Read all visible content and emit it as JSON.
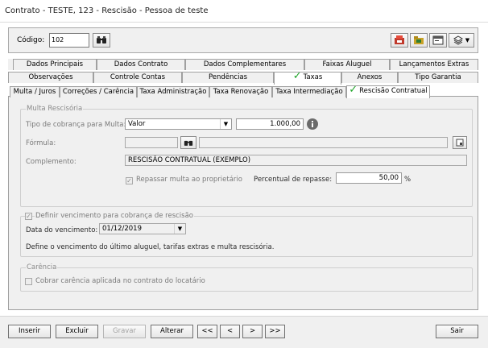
{
  "window": {
    "title": "Contrato - TESTE, 123 - Rescisão - Pessoa de teste"
  },
  "header": {
    "codigo_label": "Código:",
    "codigo_value": "102"
  },
  "tabs_row1": [
    "Dados Principais",
    "Dados Contrato",
    "Dados Complementares",
    "Faixas Aluguel",
    "Lançamentos Extras"
  ],
  "tabs_row2": [
    "Observações",
    "Controle Contas",
    "Pendências",
    "Taxas",
    "Anexos",
    "Tipo Garantia"
  ],
  "subtabs": [
    "Multa / Juros",
    "Correções / Carência",
    "Taxa Administração",
    "Taxa Renovação",
    "Taxa Intermediação",
    "Rescisão Contratual"
  ],
  "multa": {
    "group_title": "Multa Rescisória",
    "tipo_label": "Tipo de cobrança para Multa:",
    "tipo_value": "Valor",
    "valor": "1.000,00",
    "formula_label": "Fórmula:",
    "complemento_label": "Complemento:",
    "complemento_value": "RESCISÃO CONTRATUAL (EXEMPLO)",
    "repassar_label": "Repassar multa ao proprietário",
    "percentual_label": "Percentual de repasse:",
    "percentual_value": "50,00",
    "percent_sign": "%"
  },
  "vencimento": {
    "group_title": "Definir vencimento para cobrança de rescisão",
    "data_label": "Data do vencimento:",
    "data_value": "01/12/2019",
    "note": "Define o vencimento do último aluguel, tarifas extras e multa rescisória."
  },
  "carencia": {
    "group_title": "Carência",
    "cobrar_label": "Cobrar carência aplicada no contrato do locatário"
  },
  "bottom": {
    "inserir": "Inserir",
    "excluir": "Excluir",
    "gravar": "Gravar",
    "alterar": "Alterar",
    "first": "<<",
    "prev": "<",
    "next": ">",
    "last": ">>",
    "sair": "Sair"
  },
  "icons": {
    "search": "binoculars-icon",
    "info": "info-icon",
    "check_color": "#1fa52a"
  }
}
